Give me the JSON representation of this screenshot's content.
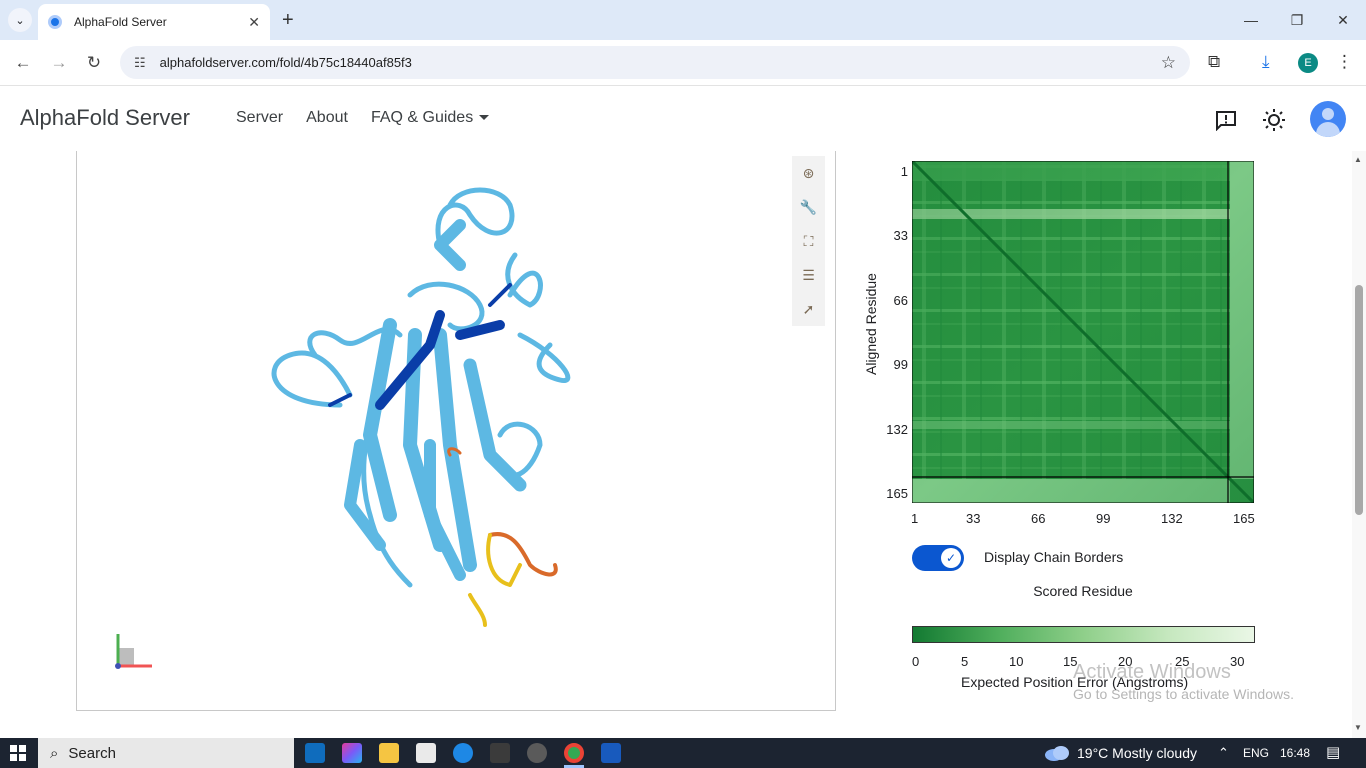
{
  "browser": {
    "tab_title": "AlphaFold Server",
    "url": "alphafoldserver.com/fold/4b75c18440af85f3",
    "profile_initial": "E"
  },
  "site": {
    "brand": "AlphaFold Server",
    "nav": [
      "Server",
      "About",
      "FAQ & Guides"
    ]
  },
  "pae": {
    "y_axis_label": "Aligned Residue",
    "x_axis_label": "Scored Residue",
    "y_ticks": [
      "1",
      "33",
      "66",
      "99",
      "132",
      "165"
    ],
    "x_ticks": [
      "1",
      "33",
      "66",
      "99",
      "132",
      "165"
    ],
    "toggle_label": "Display Chain Borders",
    "toggle_on": true,
    "legend_ticks": [
      "0",
      "5",
      "10",
      "15",
      "20",
      "25",
      "30"
    ],
    "legend_label": "Expected Position Error (Angstroms)",
    "colors": {
      "low_error": "#137a32",
      "high_error": "#eaf7e6",
      "chain_border": "#000000"
    }
  },
  "watermark": {
    "line1": "Activate Windows",
    "line2": "Go to Settings to activate Windows."
  },
  "taskbar": {
    "search": "Search",
    "weather": "19°C  Mostly cloudy",
    "language": "ENG",
    "time": "16:48"
  }
}
